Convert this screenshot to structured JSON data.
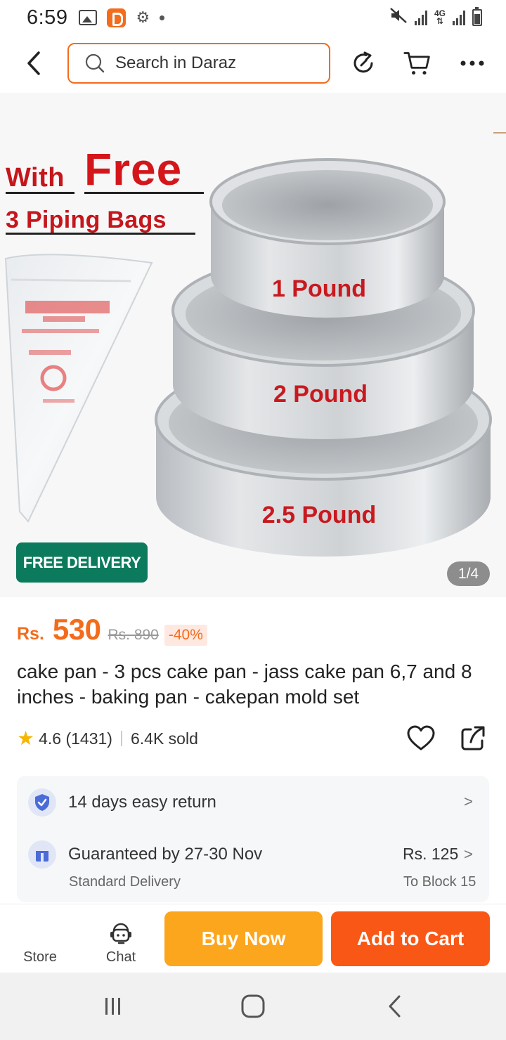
{
  "status_bar": {
    "time": "6:59",
    "network": "4G",
    "icons": [
      "gallery-icon",
      "daraz-app-icon",
      "gear-icon",
      "dot-icon",
      "mute-icon",
      "signal-icon",
      "battery-icon"
    ]
  },
  "header": {
    "search_placeholder": "Search in Daraz",
    "icons": [
      "back-icon",
      "search-icon",
      "share-arrow-icon",
      "cart-icon",
      "more-icon"
    ]
  },
  "product_image": {
    "promo": {
      "line1_with": "With",
      "line1_free": "Free",
      "line2": "3 Piping Bags"
    },
    "pan_labels": [
      "1 Pound",
      "2 Pound",
      "2.5 Pound"
    ],
    "badge": "FREE DELIVERY",
    "counter": "1/4"
  },
  "price": {
    "currency": "Rs.",
    "current": "530",
    "original": "Rs. 890",
    "discount": "-40%"
  },
  "product": {
    "title": "cake pan - 3 pcs cake pan - jass cake pan 6,7 and 8 inches - baking pan - cakepan mold set",
    "rating": "4.6",
    "rating_count": "(1431)",
    "sold": "6.4K sold"
  },
  "services": {
    "return_text": "14 days easy return",
    "guarantee_text": "Guaranteed by 27-30 Nov",
    "delivery_type": "Standard Delivery",
    "delivery_price": "Rs. 125",
    "delivery_location": "To Block 15"
  },
  "bottom_bar": {
    "store_label": "Store",
    "chat_label": "Chat",
    "buy_now_label": "Buy Now",
    "add_to_cart_label": "Add to Cart"
  },
  "colors": {
    "accent": "#f36c1c",
    "buy_now": "#fca61d",
    "add_to_cart": "#f95716",
    "free_delivery": "#0b7a5d",
    "star": "#f7b500",
    "promo_red": "#c4161c"
  }
}
